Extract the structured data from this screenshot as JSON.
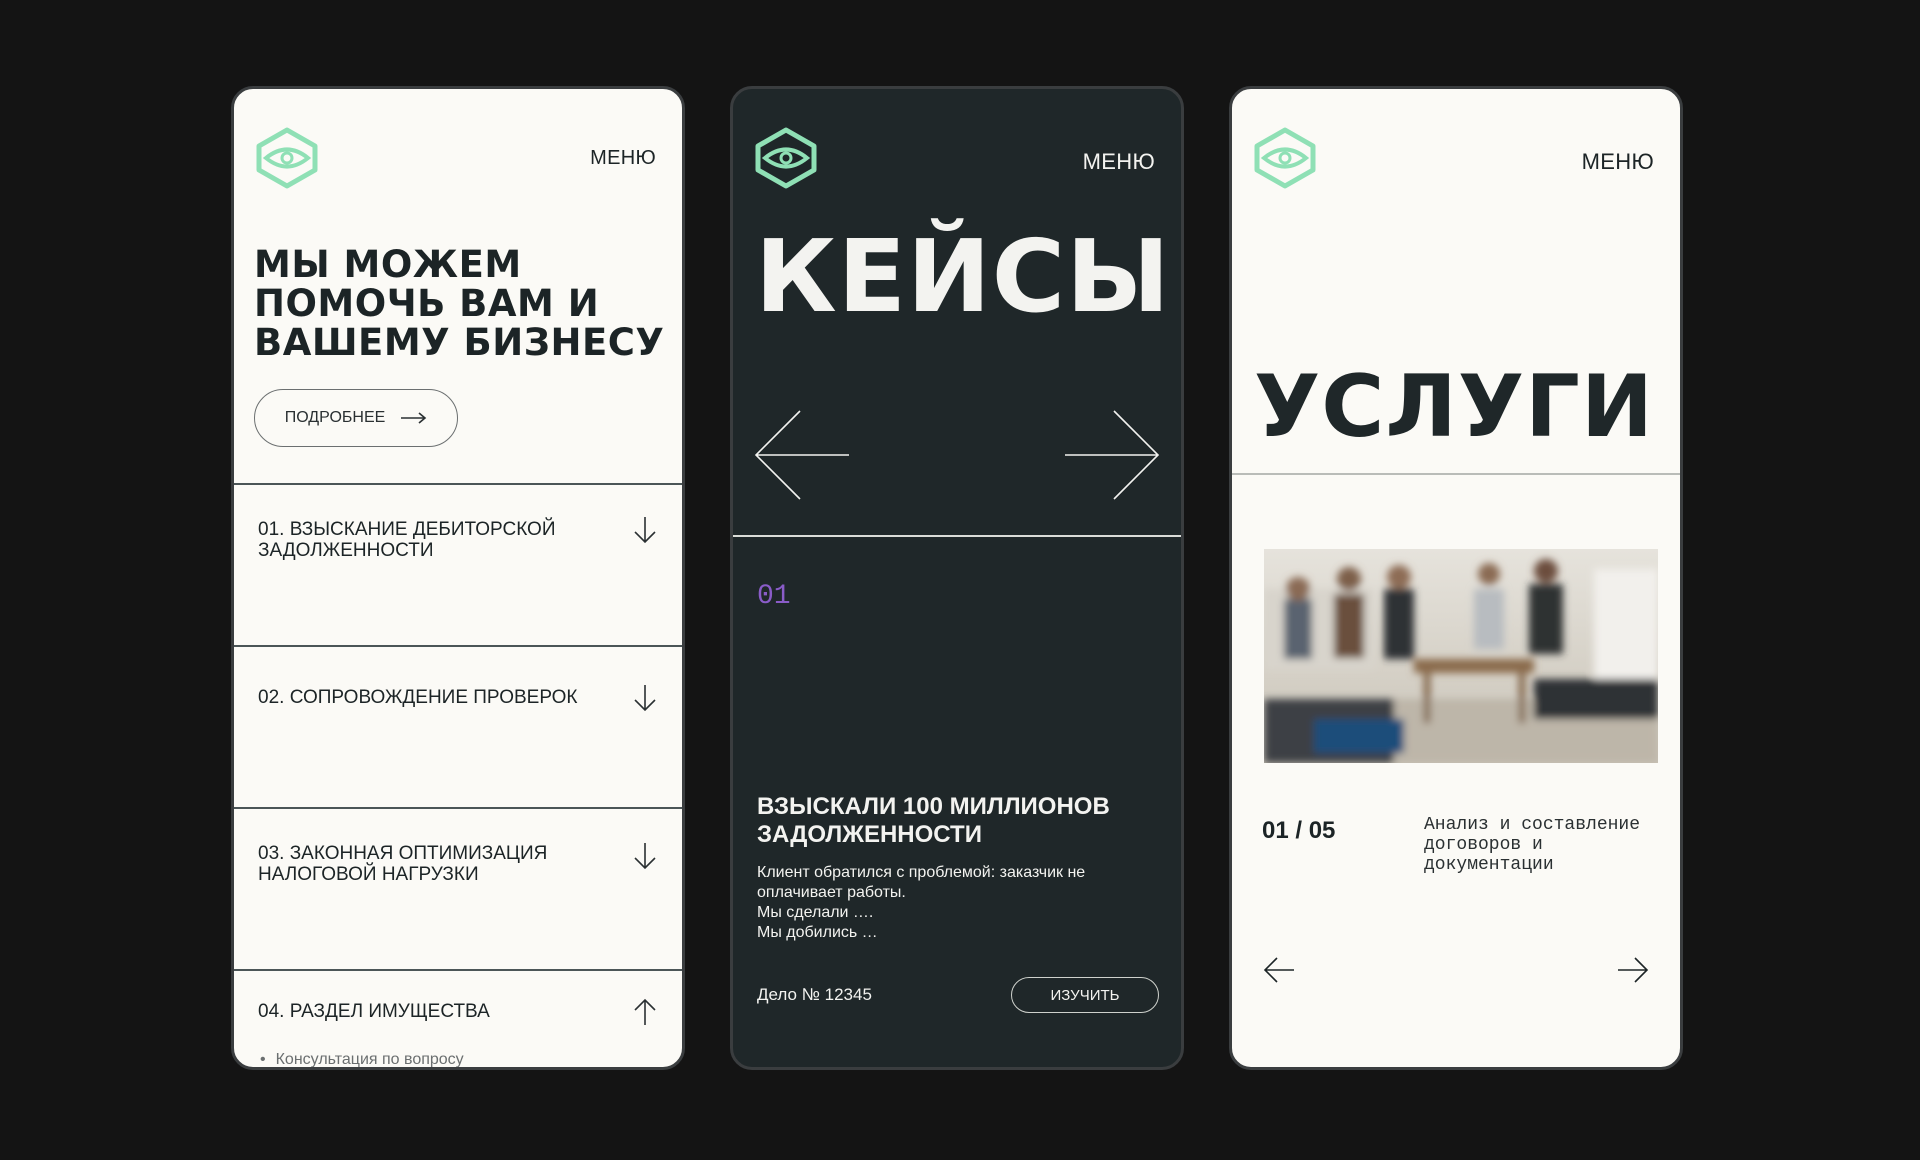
{
  "colors": {
    "accent": "#8fe0b5",
    "dark_bg": "#1f2729",
    "light_bg": "#fbfaf6",
    "case_number": "#8a5cc8"
  },
  "screen1": {
    "menu": "МЕНЮ",
    "headline": [
      "МЫ МОЖЕМ",
      "ПОМОЧЬ ВАМ И",
      "ВАШЕМУ БИЗНЕСУ"
    ],
    "more_button": "ПОДРОБНЕЕ",
    "accordion": [
      {
        "title_lines": [
          "01. ВЗЫСКАНИЕ ДЕБИТОРСКОЙ",
          "ЗАДОЛЖЕННОСТИ"
        ],
        "icon": "arrow-down-icon"
      },
      {
        "title_lines": [
          "02. СОПРОВОЖДЕНИЕ ПРОВЕРОК"
        ],
        "icon": "arrow-down-icon"
      },
      {
        "title_lines": [
          "03. ЗАКОННАЯ ОПТИМИЗАЦИЯ",
          "НАЛОГОВОЙ НАГРУЗКИ"
        ],
        "icon": "arrow-down-icon"
      },
      {
        "title_lines": [
          "04. РАЗДЕЛ ИМУЩЕСТВА"
        ],
        "icon": "arrow-up-icon",
        "sub_item": "Консультация по вопросу"
      }
    ]
  },
  "screen2": {
    "menu": "МЕНЮ",
    "title": "КЕЙСЫ",
    "case_number": "01",
    "case_title_lines": [
      "ВЗЫСКАЛИ 100 МИЛЛИОНОВ",
      "ЗАДОЛЖЕННОСТИ"
    ],
    "case_description": [
      "Клиент обратился с проблемой: заказчик не",
      "оплачивает работы.",
      "Мы сделали ….",
      "Мы добились …"
    ],
    "case_id": "Дело № 12345",
    "study_button": "ИЗУЧИТЬ"
  },
  "screen3": {
    "menu": "МЕНЮ",
    "title": "УСЛУГИ",
    "counter": "01 / 05",
    "description_lines": [
      "Анализ и составление",
      "договоров и",
      "документации"
    ]
  }
}
